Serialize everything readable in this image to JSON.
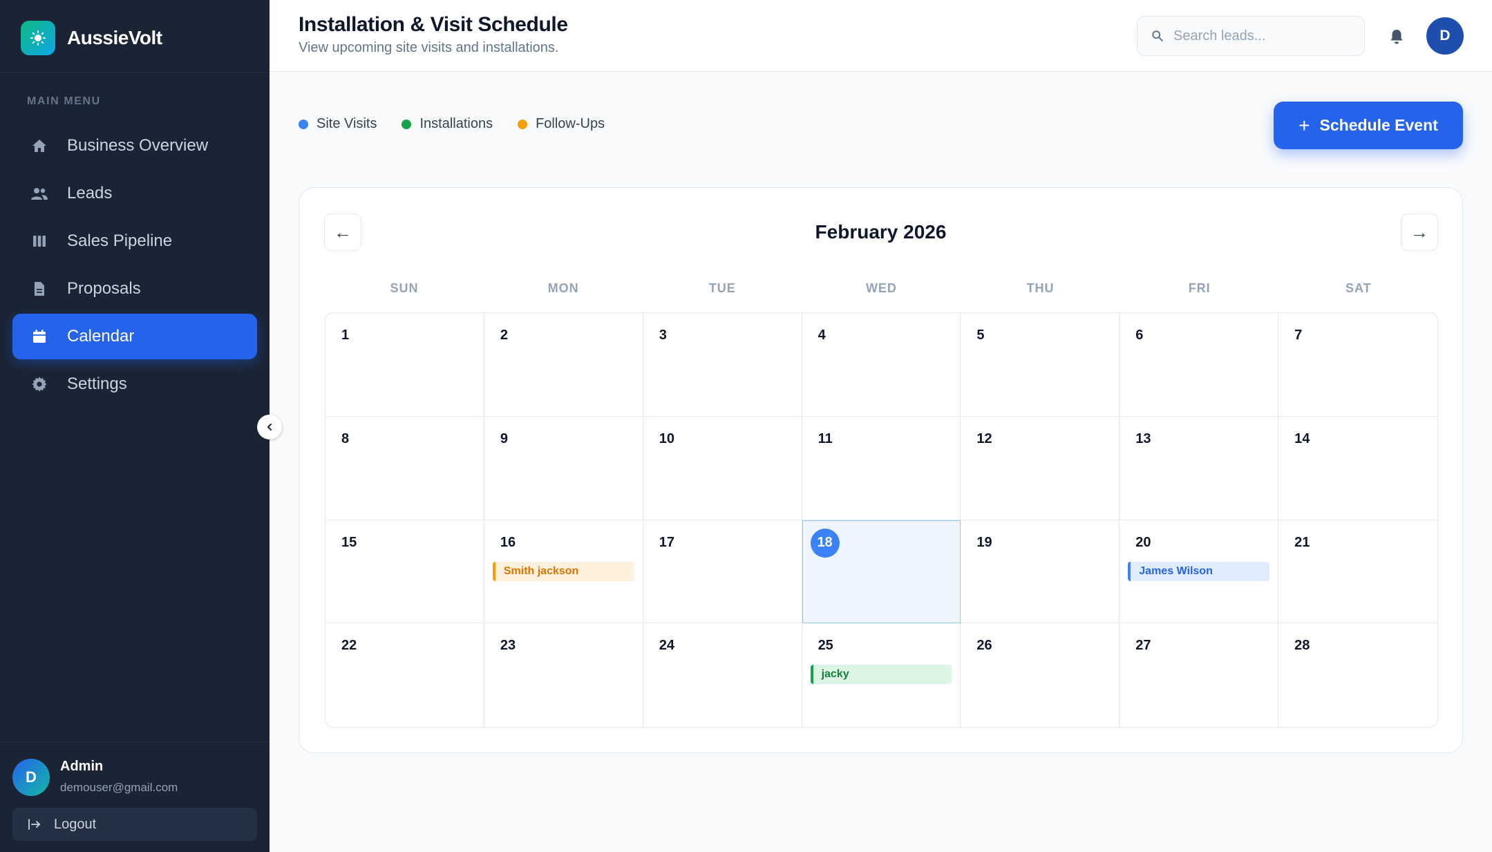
{
  "colors": {
    "site_visit": "#3b82f6",
    "installation": "#16a34a",
    "follow_up": "#f59e0b",
    "accent": "#2563eb",
    "sidebar_bg": "#1a2435"
  },
  "brand": {
    "name": "AussieVolt",
    "icon": "sun-icon"
  },
  "sidebar": {
    "menu_heading": "MAIN MENU",
    "items": [
      {
        "label": "Business Overview",
        "icon": "home-icon"
      },
      {
        "label": "Leads",
        "icon": "users-icon"
      },
      {
        "label": "Sales Pipeline",
        "icon": "columns-icon"
      },
      {
        "label": "Proposals",
        "icon": "document-icon"
      },
      {
        "label": "Calendar",
        "icon": "calendar-icon",
        "active": true
      },
      {
        "label": "Settings",
        "icon": "gear-icon"
      }
    ],
    "collapse_icon": "chevron-left-icon",
    "user": {
      "initial": "D",
      "name": "Admin",
      "email": "demouser@gmail.com"
    },
    "logout_label": "Logout"
  },
  "header": {
    "title": "Installation & Visit Schedule",
    "subtitle": "View upcoming site visits and installations.",
    "search_placeholder": "Search leads...",
    "avatar_initial": "D"
  },
  "legend": [
    {
      "label": "Site Visits",
      "color": "#3b82f6"
    },
    {
      "label": "Installations",
      "color": "#16a34a"
    },
    {
      "label": "Follow-Ups",
      "color": "#f59e0b"
    }
  ],
  "schedule_button": {
    "label": "Schedule Event"
  },
  "calendar": {
    "month_label": "February 2026",
    "prev_label": "←",
    "next_label": "→",
    "weekdays": [
      "SUN",
      "MON",
      "TUE",
      "WED",
      "THU",
      "FRI",
      "SAT"
    ],
    "today": 18,
    "days": [
      1,
      2,
      3,
      4,
      5,
      6,
      7,
      8,
      9,
      10,
      11,
      12,
      13,
      14,
      15,
      16,
      17,
      18,
      19,
      20,
      21,
      22,
      23,
      24,
      25,
      26,
      27,
      28
    ],
    "events": [
      {
        "day": 16,
        "title": "Smith jackson",
        "type": "follow_up"
      },
      {
        "day": 20,
        "title": "James Wilson",
        "type": "site_visit"
      },
      {
        "day": 25,
        "title": "jacky",
        "type": "installation"
      }
    ]
  }
}
